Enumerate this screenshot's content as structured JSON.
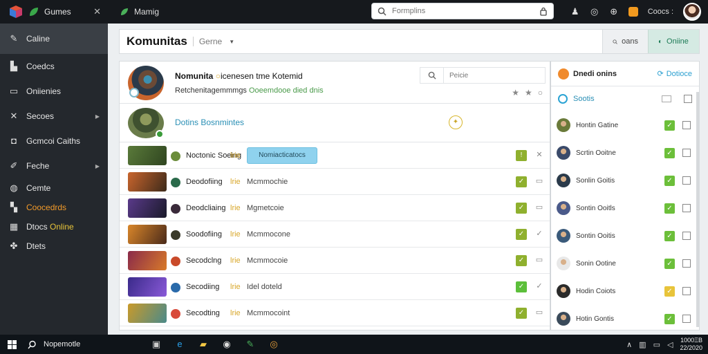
{
  "topbar": {
    "app_title": "Gumes",
    "window_title": "Mamig",
    "search_placeholder": "Formplins",
    "user_label": "Coocs :"
  },
  "sidebar": {
    "items": [
      {
        "label": "Caline",
        "icon": "wrench-icon"
      },
      {
        "label": "Coedcs",
        "icon": "chart-icon"
      },
      {
        "label": "Oniienies",
        "icon": "monitor-icon"
      },
      {
        "label": "Secoes",
        "icon": "tools-icon"
      },
      {
        "label": "Gcmcoi Caiths",
        "icon": "gamepad-icon"
      },
      {
        "label": "Feche",
        "icon": "pencil-icon"
      },
      {
        "label": "Cemte",
        "icon": "controller-icon"
      },
      {
        "label": "Coocedrds",
        "icon": "handshake-icon"
      },
      {
        "label": "Dtocs",
        "label_b": "Online",
        "icon": "grid-icon"
      },
      {
        "label": "Dtets",
        "icon": "group-icon"
      }
    ]
  },
  "header": {
    "title": "Komunitas",
    "subtitle": "Gerne",
    "btn_posts": "oans",
    "btn_online": "Oniine"
  },
  "game_header": {
    "title_a": "Nomunita",
    "title_b": "icenesen tme Kotemid",
    "subtitle_a": "Retchenitagemmmgs",
    "subtitle_b": "Ooeemdooe died dnis",
    "search_placeholder": "Peicie"
  },
  "featured": {
    "title": "Dotins Bosnmintes"
  },
  "games": [
    {
      "name": "Noctonic Soeing",
      "tag": "lrie",
      "desc": "",
      "button": "Nomiacticatocs",
      "thumb": "#5a7a3a",
      "thumb2": "#2f4520",
      "mini": "#6a8c3a",
      "check": "#8fb02e",
      "check_label": "!",
      "act": "✕"
    },
    {
      "name": "Deodofiing",
      "tag": "lrie",
      "desc": "Mcmmochie",
      "button": "",
      "thumb": "#c9652d",
      "thumb2": "#3d2a1a",
      "mini": "#2a6a4a",
      "check": "#8fb02e",
      "check_label": "✓",
      "act": "▭"
    },
    {
      "name": "Deodcliaing",
      "tag": "lrie",
      "desc": "Mgmetcoie",
      "button": "",
      "thumb": "#5a3a8a",
      "thumb2": "#1a1a2a",
      "mini": "#3a2a3a",
      "check": "#8fb02e",
      "check_label": "✓",
      "act": "▭"
    },
    {
      "name": "Soodofiing",
      "tag": "lrie",
      "desc": "Mcmmocone",
      "button": "",
      "thumb": "#d9862a",
      "thumb2": "#4a2a1a",
      "mini": "#3a3a2a",
      "check": "#8fb02e",
      "check_label": "✓",
      "act": "✓"
    },
    {
      "name": "Secodclng",
      "tag": "lrie",
      "desc": "Mcmmocoie",
      "button": "",
      "thumb": "#8a2a4a",
      "thumb2": "#d87a2a",
      "mini": "#c94a2a",
      "check": "#8fb02e",
      "check_label": "✓",
      "act": "▭"
    },
    {
      "name": "Secodiing",
      "tag": "lrie",
      "desc": "Idel doteld",
      "button": "",
      "thumb": "#3a2a8a",
      "thumb2": "#8a5ad8",
      "mini": "#2a6aaa",
      "check": "#5cbf3a",
      "check_label": "✓",
      "act": "✓"
    },
    {
      "name": "Secodting",
      "tag": "lrie",
      "desc": "Mcmmocoint",
      "button": "",
      "thumb": "#c99a2a",
      "thumb2": "#4a8a8a",
      "mini": "#d84a3a",
      "check": "#8fb02e",
      "check_label": "✓",
      "act": "▭"
    }
  ],
  "friends": {
    "title": "Dnedi onins",
    "action": "Dotioce",
    "section": "Sootis",
    "list": [
      {
        "name": "Hontin Gatine",
        "avatar": "#6a7a3a",
        "check": "#6cbf3a"
      },
      {
        "name": "Scrtin Ooitne",
        "avatar": "#3a4a6a",
        "check": "#6cbf3a"
      },
      {
        "name": "Sonlin Goitis",
        "avatar": "#2a3a4a",
        "check": "#6cbf3a"
      },
      {
        "name": "Sontin Ooitls",
        "avatar": "#4a5a8a",
        "check": "#6cbf3a"
      },
      {
        "name": "Sontin Ooitis",
        "avatar": "#3a5a7a",
        "check": "#6cbf3a"
      },
      {
        "name": "Sonin Ootine",
        "avatar": "#e8e8e8",
        "check": "#6cbf3a"
      },
      {
        "name": "Hodin Coiots",
        "avatar": "#2a2a2a",
        "check": "#e8c43a"
      },
      {
        "name": "Hotin Gontis",
        "avatar": "#3a4a5a",
        "check": "#6cbf3a"
      }
    ]
  },
  "taskbar": {
    "search_text": "Nopemotle",
    "time": "1000ΞΒ",
    "date": "22/2020"
  }
}
